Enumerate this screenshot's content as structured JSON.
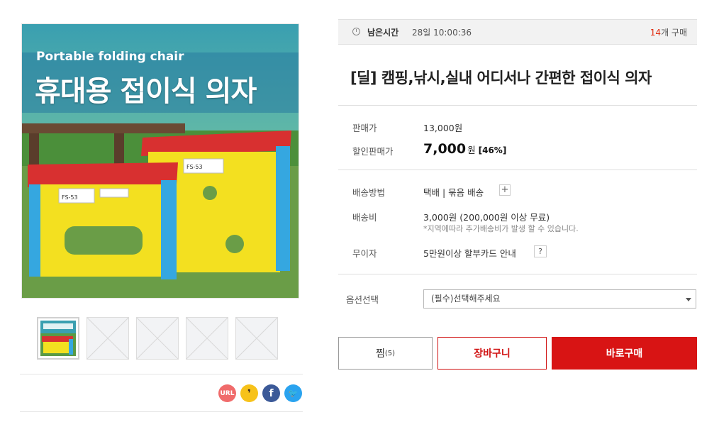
{
  "product_image": {
    "subtitle_en": "Portable folding chair",
    "title_ko": "휴대용 접이식 의자",
    "stool_label_small": "FS-53",
    "stool_label_large": "FS-53"
  },
  "thumbnails": {
    "active": {
      "caption": "휴대용 접이식 의자"
    },
    "placeholders": 4
  },
  "share": {
    "url_label": "URL",
    "kakao_label": "❜",
    "facebook_label": "f",
    "twitter_label": "🐦"
  },
  "timer": {
    "label": "남은시간",
    "value": "28일 10:00:36",
    "count": "14",
    "count_suffix": "개 구매"
  },
  "title": "[딜] 캠핑,낚시,실내 어디서나 간편한 접이식 의자",
  "price": {
    "list_label": "판매가",
    "list_value": "13,000원",
    "sale_label": "할인판매가",
    "sale_value": "7,000",
    "sale_unit": "원",
    "discount": "[46%]"
  },
  "shipping": {
    "method_label": "배송방법",
    "method_value": "택배 | 묶음 배송",
    "method_plus": "+",
    "fee_label": "배송비",
    "fee_value": "3,000원 (200,000원 이상 무료)",
    "fee_note": "*지역에따라 추가배송비가 발생 할 수 있습니다.",
    "installment_label": "무이자",
    "installment_value": "5만원이상 할부카드 안내",
    "installment_help": "?"
  },
  "option": {
    "label": "옵션선택",
    "placeholder": "(필수)선택해주세요"
  },
  "buttons": {
    "wish": "찜",
    "wish_count": "(5)",
    "cart": "장바구니",
    "buy": "바로구매"
  },
  "colors": {
    "accent_red": "#d81414",
    "count_red": "#e0270a",
    "url_bg": "#f06b6b",
    "kakao_bg": "#f7c21a",
    "facebook_bg": "#3b5998",
    "twitter_bg": "#2aa3ef"
  }
}
